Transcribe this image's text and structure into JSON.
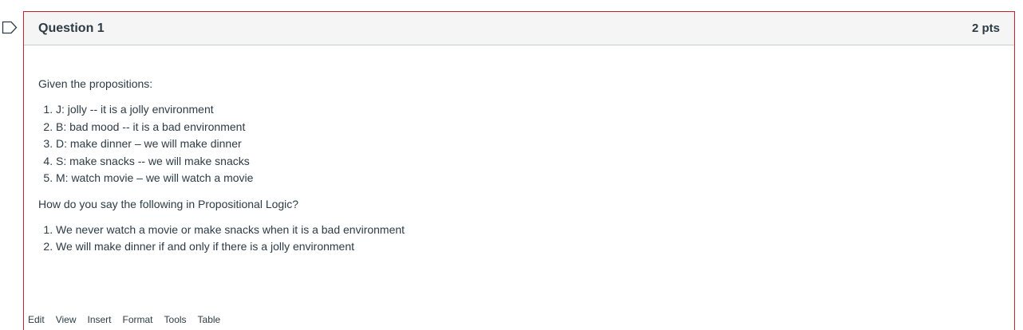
{
  "question": {
    "title": "Question 1",
    "points": "2 pts",
    "intro": "Given the propositions:",
    "propositions": [
      "J: jolly -- it is a jolly environment",
      "B: bad mood -- it is a bad environment",
      "D: make dinner – we will make dinner",
      "S: make snacks -- we will make snacks",
      "M: watch movie – we will watch a movie"
    ],
    "prompt": "How do you say the following in Propositional Logic?",
    "statements": [
      "We never watch a movie or make snacks when it is a bad environment",
      "We will make dinner if and only if there is a jolly environment"
    ]
  },
  "editor": {
    "menu": [
      "Edit",
      "View",
      "Insert",
      "Format",
      "Tools",
      "Table"
    ]
  },
  "colors": {
    "accent_border": "#c8202f",
    "header_bg": "#f5f5f5",
    "text": "#2d3b45"
  },
  "icons": {
    "flag": "bookmark-flag-icon"
  }
}
